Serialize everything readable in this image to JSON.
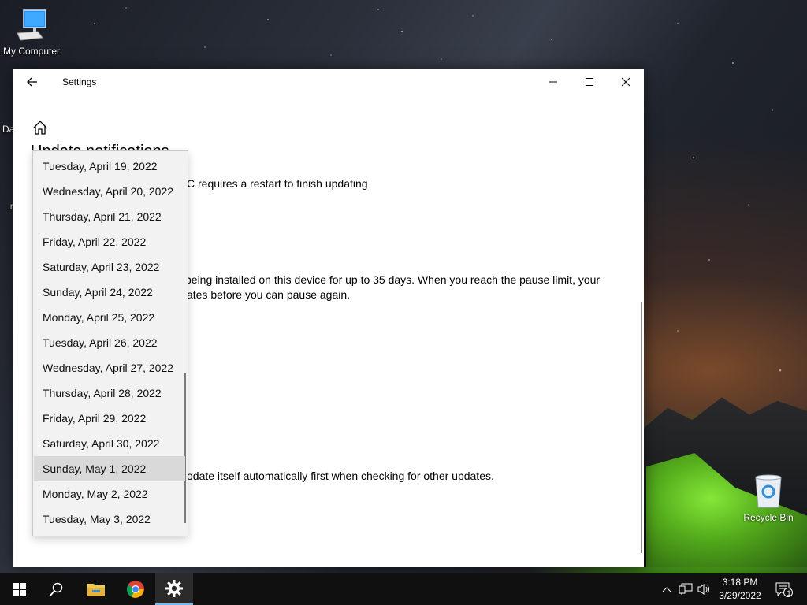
{
  "desktop": {
    "icons": [
      {
        "label": "My Computer"
      },
      {
        "label": "Recycle Bin"
      }
    ],
    "partial_labels": [
      "Da",
      "r"
    ]
  },
  "window": {
    "title": "Settings",
    "heading": "Update notifications",
    "lines": [
      "C requires a restart to finish updating",
      " being installed on this device for up to 35 days. When you reach the pause limit, your",
      "ates before you can pause again.",
      "odate itself automatically first when checking for other updates."
    ]
  },
  "dropdown": {
    "items": [
      "Tuesday, April 19, 2022",
      "Wednesday, April 20, 2022",
      "Thursday, April 21, 2022",
      "Friday, April 22, 2022",
      "Saturday, April 23, 2022",
      "Sunday, April 24, 2022",
      "Monday, April 25, 2022",
      "Tuesday, April 26, 2022",
      "Wednesday, April 27, 2022",
      "Thursday, April 28, 2022",
      "Friday, April 29, 2022",
      "Saturday, April 30, 2022",
      "Sunday, May 1, 2022",
      "Monday, May 2, 2022",
      "Tuesday, May 3, 2022"
    ],
    "selected_index": 12
  },
  "taskbar": {
    "pinned": [
      "start",
      "search",
      "file-explorer",
      "chrome",
      "settings"
    ],
    "active": "settings",
    "time": "3:18 PM",
    "date": "3/29/2022",
    "notification_count": "1"
  },
  "colors": {
    "accent": "#76b9ed",
    "link": "#0067b8",
    "dropdown_bg": "#f2f2f2",
    "dropdown_selected": "#d9d9d9"
  }
}
